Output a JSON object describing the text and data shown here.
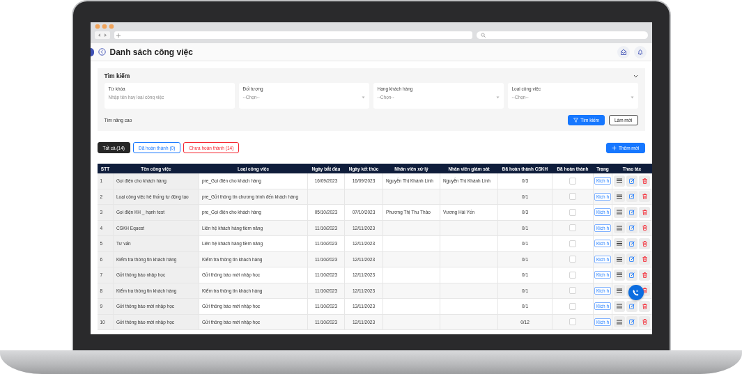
{
  "page": {
    "title": "Danh sách công việc"
  },
  "search": {
    "title": "Tìm kiếm",
    "expanded": true,
    "fields": [
      {
        "kind": "text",
        "label": "Từ khóa",
        "placeholder": "Nhập tên hay loại công việc"
      },
      {
        "kind": "select",
        "label": "Đối tượng",
        "placeholder": "--Chọn--"
      },
      {
        "kind": "select",
        "label": "Hạng khách hàng",
        "placeholder": "--Chọn--"
      },
      {
        "kind": "select",
        "label": "Loại công việc",
        "placeholder": "--Chọn--"
      }
    ],
    "advanced_link": "Tìm nâng cao",
    "search_button": "Tìm kiếm",
    "reset_button": "Làm mới"
  },
  "tabs": [
    {
      "label": "Tất cả (14)",
      "selected": true,
      "color": "#262626"
    },
    {
      "label": "Đã hoàn thành (0)",
      "selected": false,
      "color": "#1677ff"
    },
    {
      "label": "Chưa hoàn thành (14)",
      "selected": false,
      "color": "#f5222d"
    }
  ],
  "add_button": "Thêm mới",
  "table": {
    "columns": [
      "STT",
      "Tên công việc",
      "Loại công việc",
      "Ngày bắt đầu",
      "Ngày kết thúc",
      "Nhân viên xử lý",
      "Nhân viên giám sát",
      "Đã hoàn thành CSKH",
      "Đã hoàn thành",
      "Trạng",
      "Thao tác"
    ],
    "rows": [
      {
        "stt": "1",
        "name": "Gọi điện cho khách hàng",
        "type": "pre_Gọi điện cho khách hàng",
        "start": "16/09/2023",
        "end": "16/09/2023",
        "handler": "Nguyễn Thị Khánh Linh",
        "supervisor": "Nguyễn Thị Khánh Linh",
        "cskh": "0/3",
        "done": false,
        "status": "Kich h"
      },
      {
        "stt": "2",
        "name": "Loại công việc hệ thống tự động tạo",
        "type": "pre_Gửi thông tin chương trình đến khách hàng",
        "cskh": "0/1",
        "done": false,
        "status": "Kich h"
      },
      {
        "stt": "3",
        "name": "Gọi điện KH _ hạnh test",
        "type": "pre_Gọi điện cho khách hàng",
        "start": "05/10/2023",
        "end": "07/10/2023",
        "handler": "Phương Thị Thu Thảo",
        "supervisor": "Vương Hải Yến",
        "cskh": "0/3",
        "done": false,
        "status": "Kich h"
      },
      {
        "stt": "4",
        "name": "CSKH Equest",
        "type": "Liên hệ khách hàng tiềm năng",
        "start": "11/10/2023",
        "end": "12/11/2023",
        "cskh": "0/1",
        "done": false,
        "status": "Kich h"
      },
      {
        "stt": "5",
        "name": "Tư vấn",
        "type": "Liên hệ khách hàng tiềm năng",
        "start": "11/10/2023",
        "end": "12/11/2023",
        "cskh": "0/1",
        "done": false,
        "status": "Kich h"
      },
      {
        "stt": "6",
        "name": "Kiểm tra thông tin khách hàng",
        "type": "Kiểm tra thông tin khách hàng",
        "start": "11/10/2023",
        "end": "12/11/2023",
        "cskh": "0/1",
        "done": false,
        "status": "Kich h"
      },
      {
        "stt": "7",
        "name": "Gửi thông báo nhập học",
        "type": "Gửi thông báo mới nhập học",
        "start": "11/10/2023",
        "end": "12/11/2023",
        "cskh": "0/1",
        "done": false,
        "status": "Kich h"
      },
      {
        "stt": "8",
        "name": "Kiểm tra thông tin khách hàng",
        "type": "Kiểm tra thông tin khách hàng",
        "start": "11/10/2023",
        "end": "12/11/2023",
        "cskh": "0/1",
        "done": false,
        "status": "Kich h"
      },
      {
        "stt": "9",
        "name": "Gửi thông báo mới nhập học",
        "type": "Gửi thông báo mới nhập học",
        "start": "11/10/2023",
        "end": "13/11/2023",
        "cskh": "0/1",
        "done": false,
        "status": "Kich h"
      },
      {
        "stt": "10",
        "name": "Gửi thông báo mới nhập học",
        "type": "Gửi thông báo mới nhập học",
        "start": "11/10/2023",
        "end": "12/11/2023",
        "cskh": "0/12",
        "done": false,
        "status": "Kich h"
      }
    ]
  }
}
